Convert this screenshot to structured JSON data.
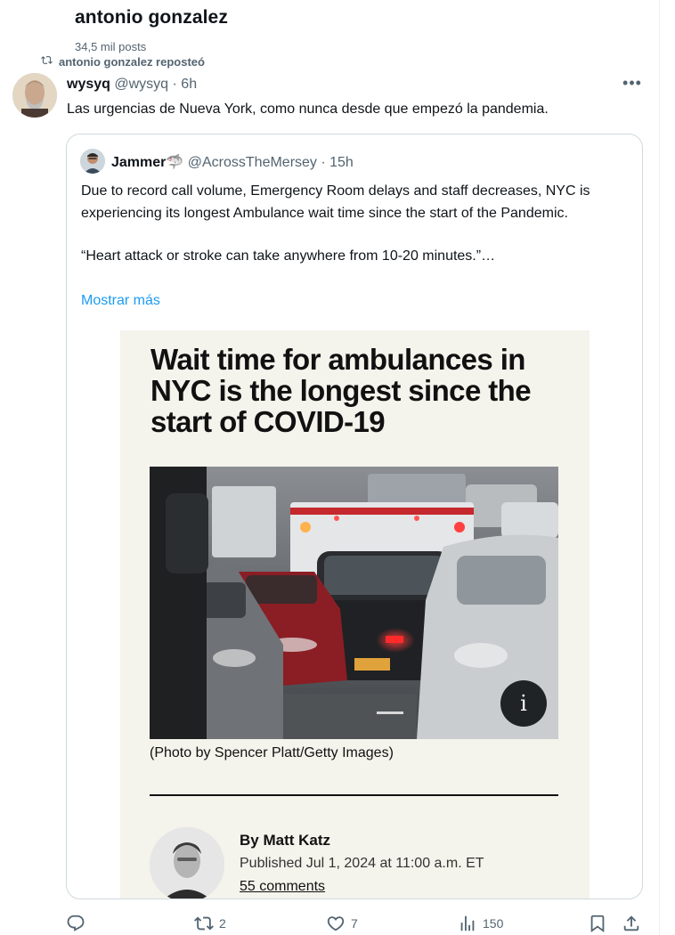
{
  "header": {
    "title": "antonio gonzalez",
    "post_count": "34,5 mil posts"
  },
  "repost": {
    "label": "antonio gonzalez reposteó"
  },
  "post": {
    "display_name": "wysyq",
    "handle_time": "@wysyq · 6h",
    "text": "Las urgencias de Nueva York, como nunca desde que empezó la pandemia."
  },
  "quote": {
    "display_name": "Jammer🦈",
    "handle_time": "@AcrossTheMersey · 15h",
    "paragraph1": "Due to record call volume, Emergency Room delays and staff decreases, NYC is experiencing its longest Ambulance wait time since the start of the Pandemic.",
    "paragraph2": "“Heart attack or stroke can take anywhere from 10-20 minutes.”…",
    "show_more": "Mostrar más"
  },
  "article": {
    "headline": "Wait time for ambulances in NYC is the longest since the start of COVID-19",
    "info_glyph": "i",
    "caption": "(Photo by Spencer Platt/Getty Images)",
    "byline": "By Matt Katz",
    "published": "Published Jul 1, 2024 at 11:00 a.m. ET",
    "comments": "55 comments"
  },
  "actions": {
    "reposts": "2",
    "likes": "7",
    "views": "150"
  },
  "colors": {
    "text_primary": "#0f1419",
    "text_secondary": "#536471",
    "accent": "#1d9bf0",
    "card_border": "#cfd9de",
    "article_bg": "#f4f3ec"
  }
}
